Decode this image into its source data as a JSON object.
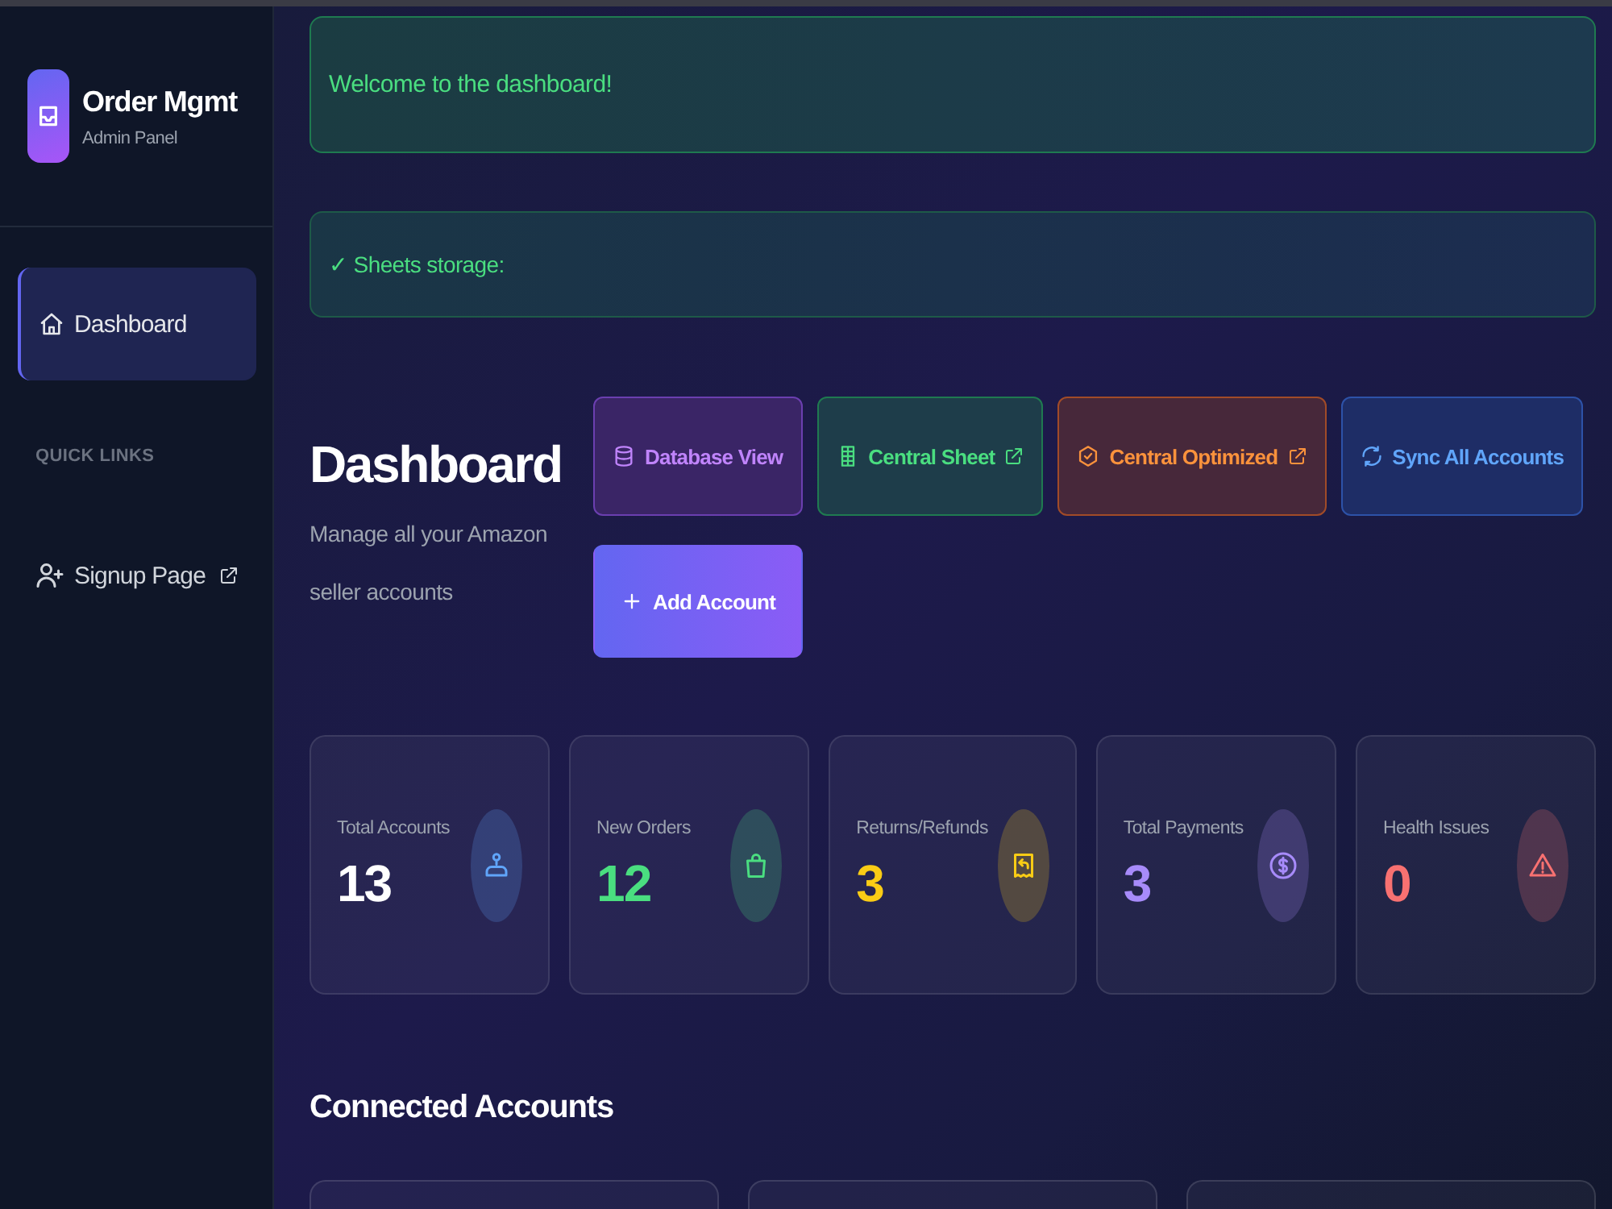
{
  "sidebar": {
    "brand": {
      "title": "Order Mgmt",
      "subtitle": "Admin Panel"
    },
    "nav": [
      {
        "kind": "dashboard",
        "label": "Dashboard",
        "selected": true
      }
    ],
    "section_label": "QUICK LINKS",
    "quick_links": [
      {
        "kind": "signup",
        "label": "Signup Page",
        "external": true
      }
    ]
  },
  "banners": [
    {
      "kind": "welcome",
      "text": "Welcome to the dashboard!"
    },
    {
      "kind": "status",
      "text": "✓ Sheets storage:"
    }
  ],
  "header": {
    "title": "Dashboard",
    "subtitle": "Manage all your Amazon seller accounts"
  },
  "actions": [
    {
      "kind": "database",
      "label": "Database View",
      "external": false
    },
    {
      "kind": "sheet",
      "label": "Central Sheet",
      "external": true
    },
    {
      "kind": "optimized",
      "label": "Central Optimized",
      "external": true
    },
    {
      "kind": "sync",
      "label": "Sync All Accounts",
      "external": false
    },
    {
      "kind": "add",
      "label": "Add Account",
      "external": false
    }
  ],
  "stats": [
    {
      "kind": "accounts",
      "label": "Total Accounts",
      "value": "13",
      "color": "#60a5fa",
      "value_highlight": false
    },
    {
      "kind": "orders",
      "label": "New Orders",
      "value": "12",
      "color": "#4ade80",
      "value_highlight": true
    },
    {
      "kind": "returns",
      "label": "Returns/Refunds",
      "value": "3",
      "color": "#facc15",
      "value_highlight": true
    },
    {
      "kind": "payments",
      "label": "Total Payments",
      "value": "3",
      "color": "#a78bfa",
      "value_highlight": true
    },
    {
      "kind": "health",
      "label": "Health Issues",
      "value": "0",
      "color": "#f87171",
      "value_highlight": true
    }
  ],
  "connected_accounts": {
    "title": "Connected Accounts",
    "cards": [
      {
        "kind": "account"
      },
      {
        "kind": "account"
      },
      {
        "kind": "account"
      }
    ]
  }
}
